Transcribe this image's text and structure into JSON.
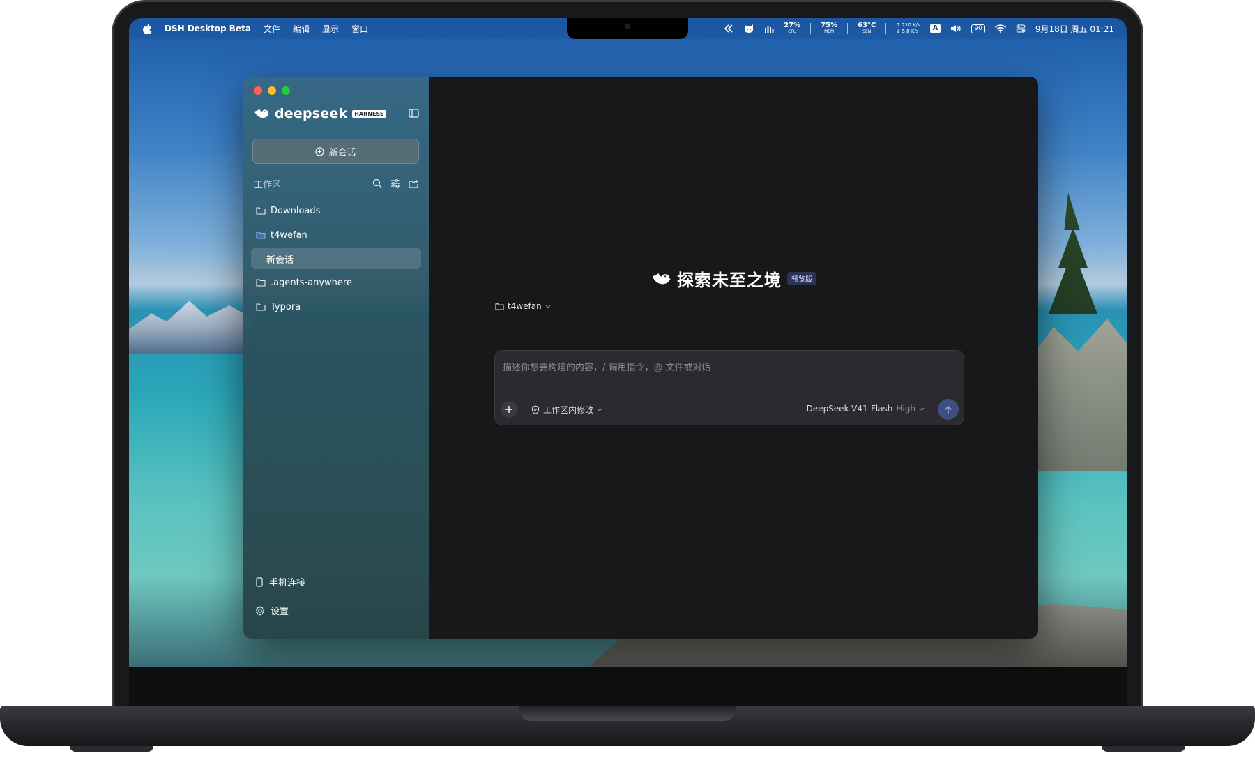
{
  "menubar": {
    "app_name": "DSH Desktop Beta",
    "menus": [
      "文件",
      "编辑",
      "显示",
      "窗口"
    ],
    "stats": {
      "cpu_value": "27%",
      "cpu_label": "CPU",
      "mem_value": "75%",
      "mem_label": "MEM",
      "sen_value": "63°C",
      "sen_label": "SEN",
      "net_up": "↑ 210 K/s",
      "net_down": "↓ 5.8 K/s"
    },
    "input_source": "A",
    "battery": "90",
    "datetime": "9月18日 周五 01:21"
  },
  "app": {
    "brand_name": "deepseek",
    "brand_badge": "HARNESS",
    "new_chat_label": "新会话",
    "workspace_label": "工作区",
    "workspaces": [
      {
        "label": "Downloads"
      },
      {
        "label": "t4wefan"
      },
      {
        "label": "新会话"
      },
      {
        "label": ".agents-anywhere"
      },
      {
        "label": "Typora"
      }
    ],
    "phone_connect_label": "手机连接",
    "settings_label": "设置"
  },
  "main": {
    "hero_title": "探索未至之境",
    "preview_badge": "预览版",
    "project_name": "t4wefan",
    "composer_placeholder": "描述你想要构建的内容，/ 调用指令，@ 文件或对话",
    "permission_label": "工作区内修改",
    "model_name": "DeepSeek-V41-Flash",
    "model_level": "High"
  },
  "colors": {
    "accent_send": "#3d4f80",
    "main_bg": "#18181a",
    "badge_bg": "#2b3456"
  }
}
